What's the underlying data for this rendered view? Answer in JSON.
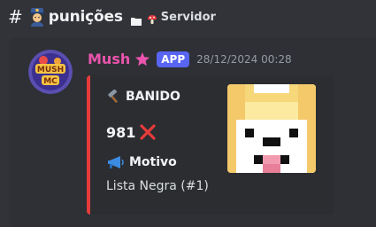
{
  "channel": {
    "hash": "#",
    "name": "punições",
    "server_label": "Servidor",
    "icons": [
      "police-officer-icon",
      "folder-icon",
      "mushroom-icon"
    ]
  },
  "message": {
    "username": "Mush",
    "username_color": "#ea54ad",
    "badge": "APP",
    "timestamp": "28/12/2024 00:28",
    "avatar_text": "MUSH MC",
    "embed": {
      "accent_color": "#e53b3b",
      "title": "BANIDO",
      "title_icon": "hammer-icon",
      "count": "981",
      "count_icon": "cross-mark-icon",
      "field_name": "Motivo",
      "field_icon": "megaphone-icon",
      "field_value": "Lista Negra (#1)"
    }
  }
}
